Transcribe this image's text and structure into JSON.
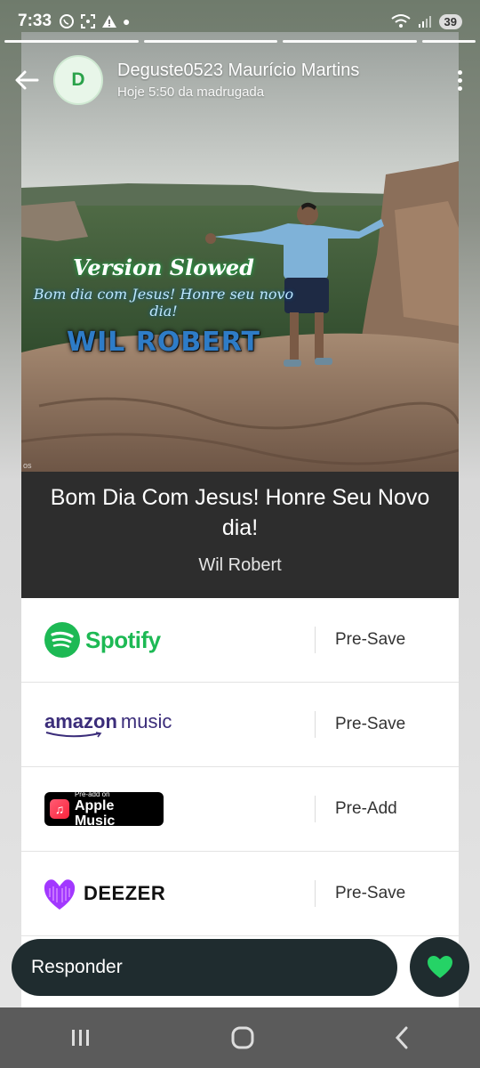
{
  "status_bar": {
    "time": "7:33",
    "battery": "39",
    "left_icons": [
      "whatsapp-icon",
      "screenshot-icon",
      "alert-icon",
      "dot-icon"
    ],
    "right_icons": [
      "wifi-icon",
      "signal-icon"
    ]
  },
  "story": {
    "progress_segments": 4,
    "contact": {
      "avatar_letter": "D",
      "name": "Deguste0523 Maurício Martins",
      "time": "Hoje 5:50 da madrugada"
    }
  },
  "album_art": {
    "line1": "Version Slowed",
    "line2": "Bom dia com Jesus! Honre seu novo dia!",
    "line3": "WIL ROBERT"
  },
  "song": {
    "title": "Bom Dia Com Jesus! Honre Seu Novo dia!",
    "artist": "Wil Robert"
  },
  "services": [
    {
      "name": "Spotify",
      "action": "Pre-Save",
      "logo": "spotify-icon"
    },
    {
      "name": "amazon",
      "name_suffix": "music",
      "action": "Pre-Save",
      "logo": "amazon-music-icon"
    },
    {
      "badge_small": "Pre-add on",
      "name": "Apple Music",
      "action": "Pre-Add",
      "logo": "apple-music-icon"
    },
    {
      "name": "DEEZER",
      "action": "Pre-Save",
      "logo": "deezer-icon"
    }
  ],
  "reply": {
    "placeholder": "Responder",
    "like_icon": "heart-icon",
    "like_color": "#25d366"
  },
  "colors": {
    "spotify": "#1db954",
    "amazon": "#3b2d7a",
    "deezer": "#a238ff",
    "title_band": "#2d2d2d",
    "reply_bg": "#1f2c2f"
  }
}
